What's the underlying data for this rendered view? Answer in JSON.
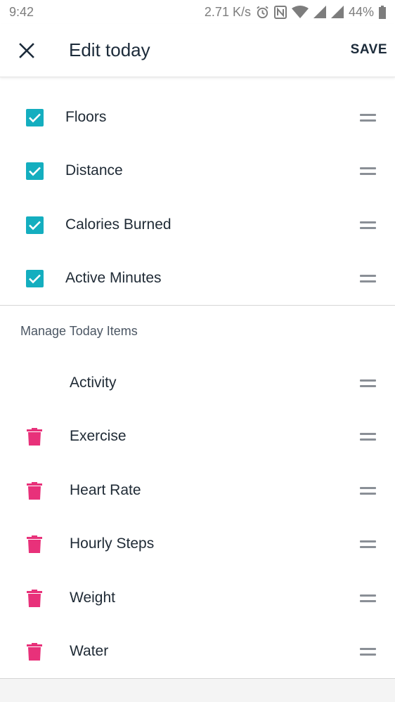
{
  "status_bar": {
    "time": "9:42",
    "network_speed": "2.71 K/s",
    "battery": "44%"
  },
  "app_bar": {
    "title": "Edit today",
    "save_label": "SAVE",
    "close_icon": "close-icon"
  },
  "checked_items": [
    {
      "label": "Floors",
      "checked": true
    },
    {
      "label": "Distance",
      "checked": true
    },
    {
      "label": "Calories Burned",
      "checked": true
    },
    {
      "label": "Active Minutes",
      "checked": true
    }
  ],
  "manage_section": {
    "title": "Manage Today Items",
    "items": [
      {
        "label": "Activity",
        "deletable": false
      },
      {
        "label": "Exercise",
        "deletable": true
      },
      {
        "label": "Heart Rate",
        "deletable": true
      },
      {
        "label": "Hourly Steps",
        "deletable": true
      },
      {
        "label": "Weight",
        "deletable": true
      },
      {
        "label": "Water",
        "deletable": true
      }
    ]
  },
  "colors": {
    "checkbox": "#14aebf",
    "trash": "#e8317a",
    "text": "#1f2a35"
  }
}
